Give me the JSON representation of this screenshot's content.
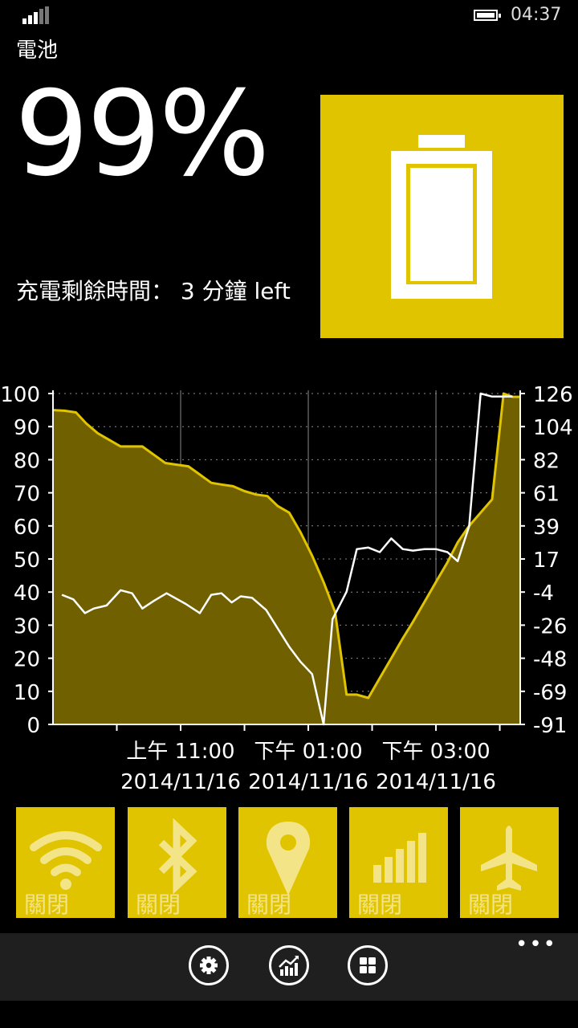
{
  "statusbar": {
    "time": "04:37"
  },
  "app_title": "電池",
  "battery": {
    "percent": "99%",
    "level": 0.99,
    "remaining": "充電剩餘時間： 3 分鐘 left"
  },
  "colors": {
    "accent": "#e1c400",
    "area_fill": "#706000",
    "secondary_line": "#ffffff"
  },
  "chart_data": {
    "type": "area",
    "y_left_ticks": [
      "100",
      "90",
      "80",
      "70",
      "60",
      "50",
      "40",
      "30",
      "20",
      "10",
      "0"
    ],
    "y_right_ticks": [
      "126",
      "104",
      "82",
      "61",
      "39",
      "17",
      "-4",
      "-26",
      "-48",
      "-69",
      "-91"
    ],
    "x_labels": [
      {
        "time": "上午 11:00",
        "date": "2014/11/16"
      },
      {
        "time": "下午 01:00",
        "date": "2014/11/16"
      },
      {
        "time": "下午 03:00",
        "date": "2014/11/16"
      }
    ],
    "ylim_left": [
      0,
      100
    ],
    "ylim_right": [
      -91,
      126
    ],
    "grid": true,
    "series": [
      {
        "axis": "left",
        "x": [
          0,
          0.09,
          0.18,
          0.26,
          0.35,
          0.44,
          0.53,
          0.62,
          0.7,
          0.79,
          0.88,
          0.97,
          1.06,
          1.15,
          1.24,
          1.32,
          1.41,
          1.5,
          1.59,
          1.68,
          1.76,
          1.85,
          1.94,
          2.03,
          2.12,
          2.21,
          2.3,
          2.38,
          2.47,
          2.56,
          2.65,
          2.74,
          2.82,
          2.91,
          3.0,
          3.09,
          3.17,
          3.26,
          3.35,
          3.44,
          3.53,
          3.6,
          3.66
        ],
        "values": [
          95,
          94.8,
          94.3,
          91,
          88,
          86,
          84,
          84,
          84,
          81.5,
          79,
          78.5,
          78,
          75.5,
          73,
          72.5,
          72,
          70.5,
          69.5,
          69,
          66,
          64,
          58,
          51,
          43,
          34,
          9,
          9,
          8,
          14,
          20,
          26,
          31,
          37,
          43,
          49,
          55,
          60,
          64,
          68,
          100,
          99,
          99
        ]
      },
      {
        "axis": "right",
        "x": [
          0.07,
          0.16,
          0.25,
          0.32,
          0.42,
          0.53,
          0.62,
          0.7,
          0.79,
          0.89,
          1.04,
          1.15,
          1.24,
          1.32,
          1.4,
          1.47,
          1.56,
          1.67,
          1.76,
          1.85,
          1.94,
          2.03,
          2.12,
          2.19,
          2.3,
          2.38,
          2.47,
          2.56,
          2.65,
          2.74,
          2.82,
          2.91,
          3.0,
          3.09,
          3.17,
          3.26,
          3.35,
          3.44,
          3.52,
          3.6
        ],
        "values": [
          -6,
          -9,
          -18,
          -15,
          -13,
          -3,
          -5,
          -15,
          -10,
          -5,
          -12,
          -18,
          -6,
          -5,
          -11,
          -7,
          -8,
          -16,
          -28,
          -40,
          -50,
          -58,
          -91,
          -22,
          -4,
          24,
          25,
          22,
          31,
          24,
          23,
          24,
          24,
          22,
          16,
          39,
          126,
          124,
          124,
          124
        ]
      }
    ]
  },
  "tiles": [
    {
      "name": "wifi",
      "icon": "wifi-icon",
      "label": "關閉"
    },
    {
      "name": "bluetooth",
      "icon": "bluetooth-icon",
      "label": "關閉"
    },
    {
      "name": "location",
      "icon": "location-icon",
      "label": "關閉"
    },
    {
      "name": "cellular",
      "icon": "cellular-signal-icon",
      "label": "關閉"
    },
    {
      "name": "airplane",
      "icon": "airplane-icon",
      "label": "關閉"
    }
  ],
  "appbar": {
    "more": "•••",
    "buttons": [
      {
        "name": "settings",
        "icon": "gear-icon"
      },
      {
        "name": "statistics",
        "icon": "chart-trend-icon"
      },
      {
        "name": "apps",
        "icon": "grid-icon"
      }
    ]
  }
}
